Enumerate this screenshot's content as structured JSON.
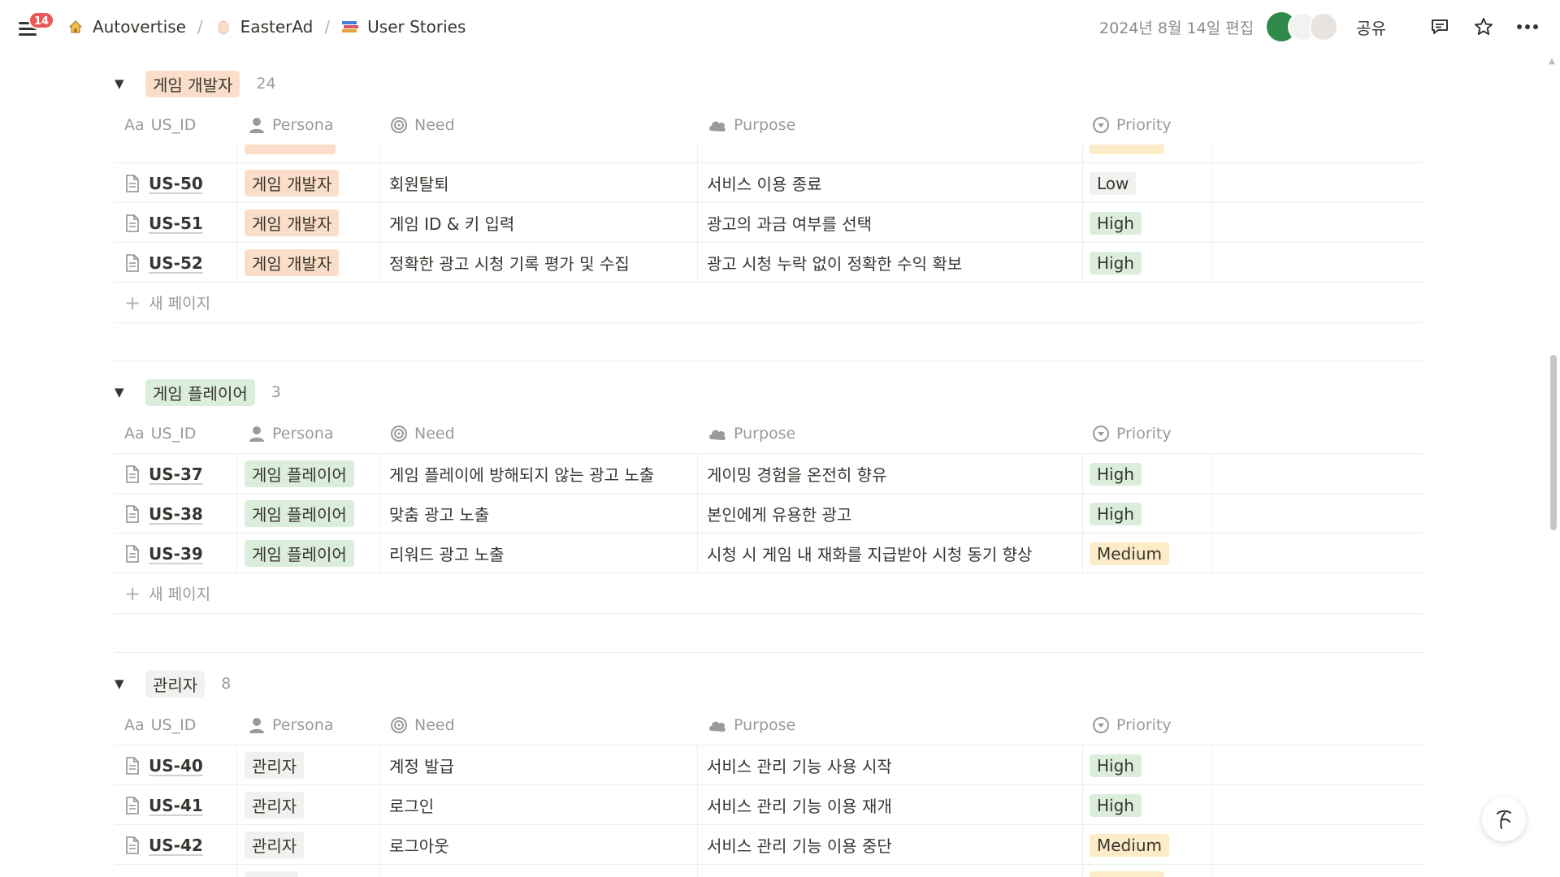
{
  "topbar": {
    "notif_count": "14",
    "breadcrumbs": [
      "Autovertise",
      "EasterAd",
      "User Stories"
    ],
    "edited": "2024년 8월 14일 편집",
    "share": "공유"
  },
  "columns": {
    "us_id": "US_ID",
    "us_id_prefix": "Aa",
    "persona": "Persona",
    "need": "Need",
    "purpose": "Purpose",
    "priority": "Priority"
  },
  "new_page": "새 페이지",
  "colors": {
    "dev_tag_bg": "#fadec9",
    "player_tag_bg": "#dbeddb",
    "admin_tag_bg": "#f1f1ef",
    "high_bg": "#dbeddb",
    "medium_bg": "#fdecc8",
    "low_bg": "#f1f1ef"
  },
  "groups": [
    {
      "name": "게임 개발자",
      "count": "24",
      "rows": [
        {
          "id": "US-50",
          "persona": "게임 개발자",
          "need": "회원탈퇴",
          "purpose": "서비스 이용 종료",
          "priority": "Low"
        },
        {
          "id": "US-51",
          "persona": "게임 개발자",
          "need": "게임 ID & 키 입력",
          "purpose": "광고의 과금 여부를 선택",
          "priority": "High"
        },
        {
          "id": "US-52",
          "persona": "게임 개발자",
          "need": "정확한 광고 시청 기록 평가 및 수집",
          "purpose": "광고 시청 누락 없이 정확한 수익 확보",
          "priority": "High"
        }
      ]
    },
    {
      "name": "게임 플레이어",
      "count": "3",
      "rows": [
        {
          "id": "US-37",
          "persona": "게임 플레이어",
          "need": "게임 플레이에 방해되지 않는 광고 노출",
          "purpose": "게이밍 경험을 온전히 향유",
          "priority": "High"
        },
        {
          "id": "US-38",
          "persona": "게임 플레이어",
          "need": "맞춤 광고 노출",
          "purpose": "본인에게 유용한 광고",
          "priority": "High"
        },
        {
          "id": "US-39",
          "persona": "게임 플레이어",
          "need": "리워드 광고 노출",
          "purpose": "시청 시 게임 내 재화를 지급받아 시청 동기 향상",
          "priority": "Medium"
        }
      ]
    },
    {
      "name": "관리자",
      "count": "8",
      "rows": [
        {
          "id": "US-40",
          "persona": "관리자",
          "need": "계정 발급",
          "purpose": "서비스 관리 기능 사용 시작",
          "priority": "High"
        },
        {
          "id": "US-41",
          "persona": "관리자",
          "need": "로그인",
          "purpose": "서비스 관리 기능 이용 재개",
          "priority": "High"
        },
        {
          "id": "US-42",
          "persona": "관리자",
          "need": "로그아웃",
          "purpose": "서비스 관리 기능 이용 중단",
          "priority": "Medium"
        }
      ]
    }
  ]
}
